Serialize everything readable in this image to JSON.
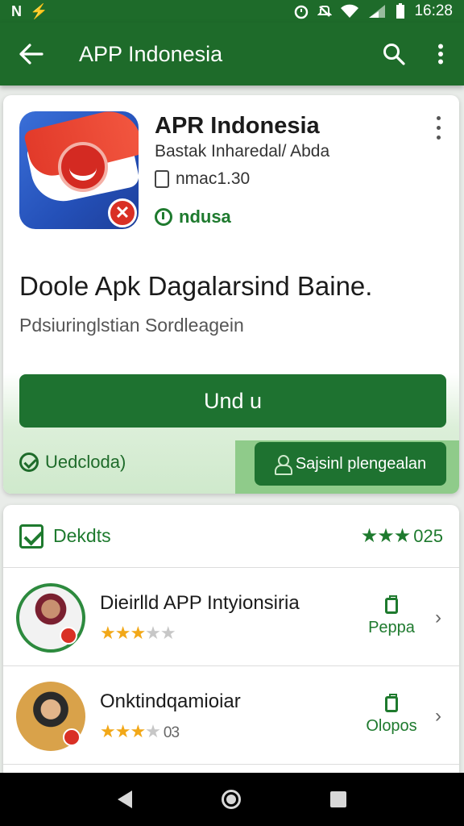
{
  "status_bar": {
    "time": "16:28",
    "left_icons": [
      "N",
      "⚡"
    ]
  },
  "app_bar": {
    "title": "APP Indonesia"
  },
  "app": {
    "name": "APR Indonesia",
    "developer": "Bastak Inharedal/ Abda",
    "size": "nmac1.30",
    "tag": "ndusa"
  },
  "headline": "Doole Apk Dagalarsind Baine.",
  "subline": "Pdsiuringlstian Sordleagein",
  "install_button": "Und u",
  "verified_label": "Uedcloda)",
  "secondary_button": "Sajsinl plengealan",
  "list": {
    "header_label": "Dekdts",
    "header_rating": "025",
    "items": [
      {
        "title": "Dieirlld APP Intyionsiria",
        "stars_on": 3,
        "stars_total": 5,
        "rating_suffix": "",
        "side_label": "Peppa"
      },
      {
        "title": "Onktindqamioiar",
        "stars_on": 3,
        "stars_total": 4,
        "rating_suffix": "03",
        "side_label": "Olopos"
      }
    ]
  },
  "colors": {
    "primary": "#1e6b2a",
    "accent": "#1e7230",
    "star": "#f2a818"
  }
}
